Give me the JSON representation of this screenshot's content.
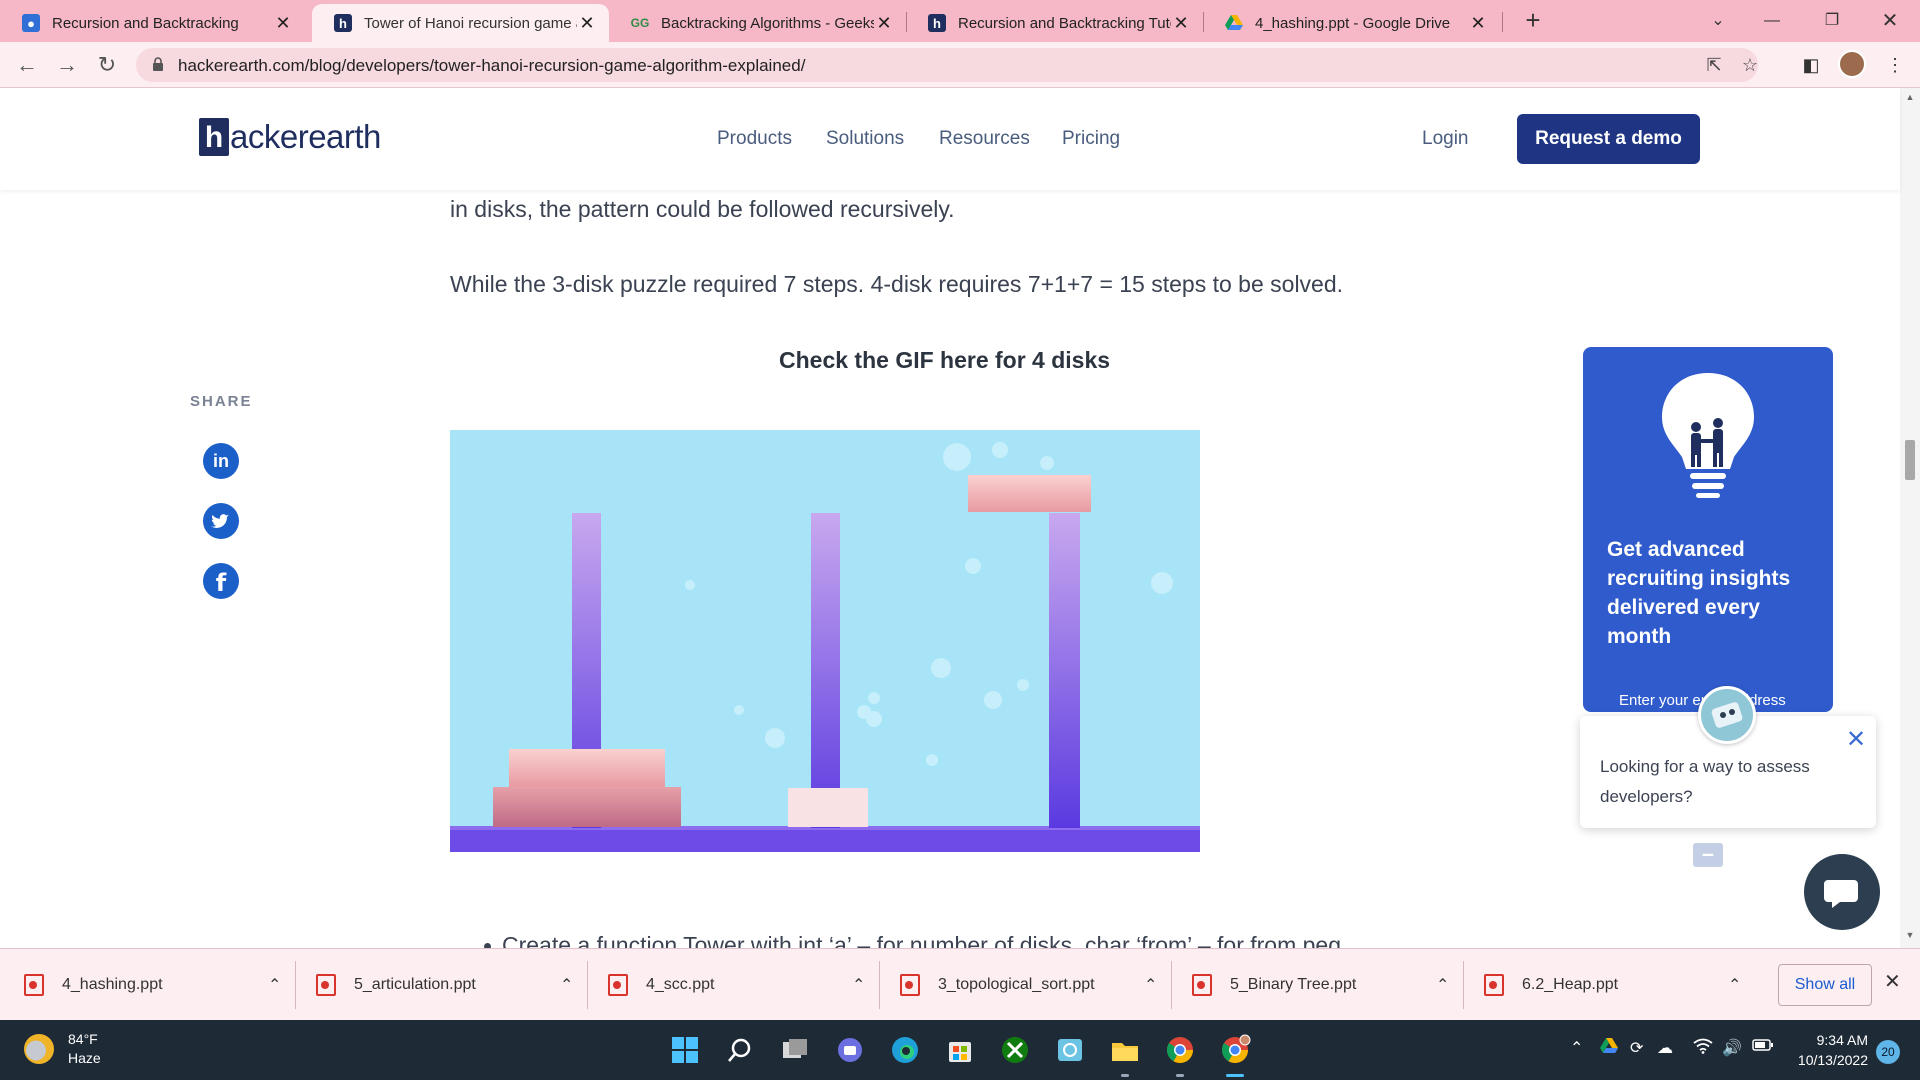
{
  "browser": {
    "tabs": [
      {
        "title": "Recursion and Backtracking",
        "favicon": "classroom-icon"
      },
      {
        "title": "Tower of Hanoi recursion game a",
        "favicon": "hackerearth-icon"
      },
      {
        "title": "Backtracking Algorithms - Geeks",
        "favicon": "geeksforgeeks-icon"
      },
      {
        "title": "Recursion and Backtracking Tuto",
        "favicon": "hackerearth-icon"
      },
      {
        "title": "4_hashing.ppt - Google Drive",
        "favicon": "google-drive-icon"
      }
    ],
    "active_tab": 1,
    "url": "hackerearth.com/blog/developers/tower-hanoi-recursion-game-algorithm-explained/"
  },
  "site": {
    "logo_h": "h",
    "logo_rest": "ackerearth",
    "nav": [
      "Products",
      "Solutions",
      "Resources",
      "Pricing"
    ],
    "login": "Login",
    "demo": "Request a demo"
  },
  "article": {
    "line1": "in disks, the pattern could be followed recursively.",
    "line2": "While the 3-disk puzzle required 7 steps. 4-disk requires 7+1+7 = 15 steps to be solved.",
    "gif_heading": "Check the GIF here for 4 disks",
    "bullet": "Create a function Tower with int ‘a’ – for number of disks, char ‘from’ – for from peg"
  },
  "share": {
    "label": "SHARE",
    "icons": [
      "linkedin-icon",
      "twitter-icon",
      "facebook-icon"
    ]
  },
  "newsletter": {
    "title": "Get advanced\nrecruiting insights\ndelivered every\nmonth",
    "email_placeholder": "Enter your email address"
  },
  "chat": {
    "message": "Looking for a way to assess developers?"
  },
  "downloads": {
    "items": [
      "4_hashing.ppt",
      "5_articulation.ppt",
      "4_scc.ppt",
      "3_topological_sort.ppt",
      "5_Binary Tree.ppt",
      "6.2_Heap.ppt"
    ],
    "show_all": "Show all"
  },
  "taskbar": {
    "temp": "84°F",
    "condition": "Haze",
    "time": "9:34 AM",
    "date": "10/13/2022",
    "notifications": "20"
  },
  "colors": {
    "brand_navy": "#1f2e5f",
    "demo_button": "#1f3584",
    "card_blue": "#2f5bcc",
    "tab_strip": "#f6b8c6"
  }
}
